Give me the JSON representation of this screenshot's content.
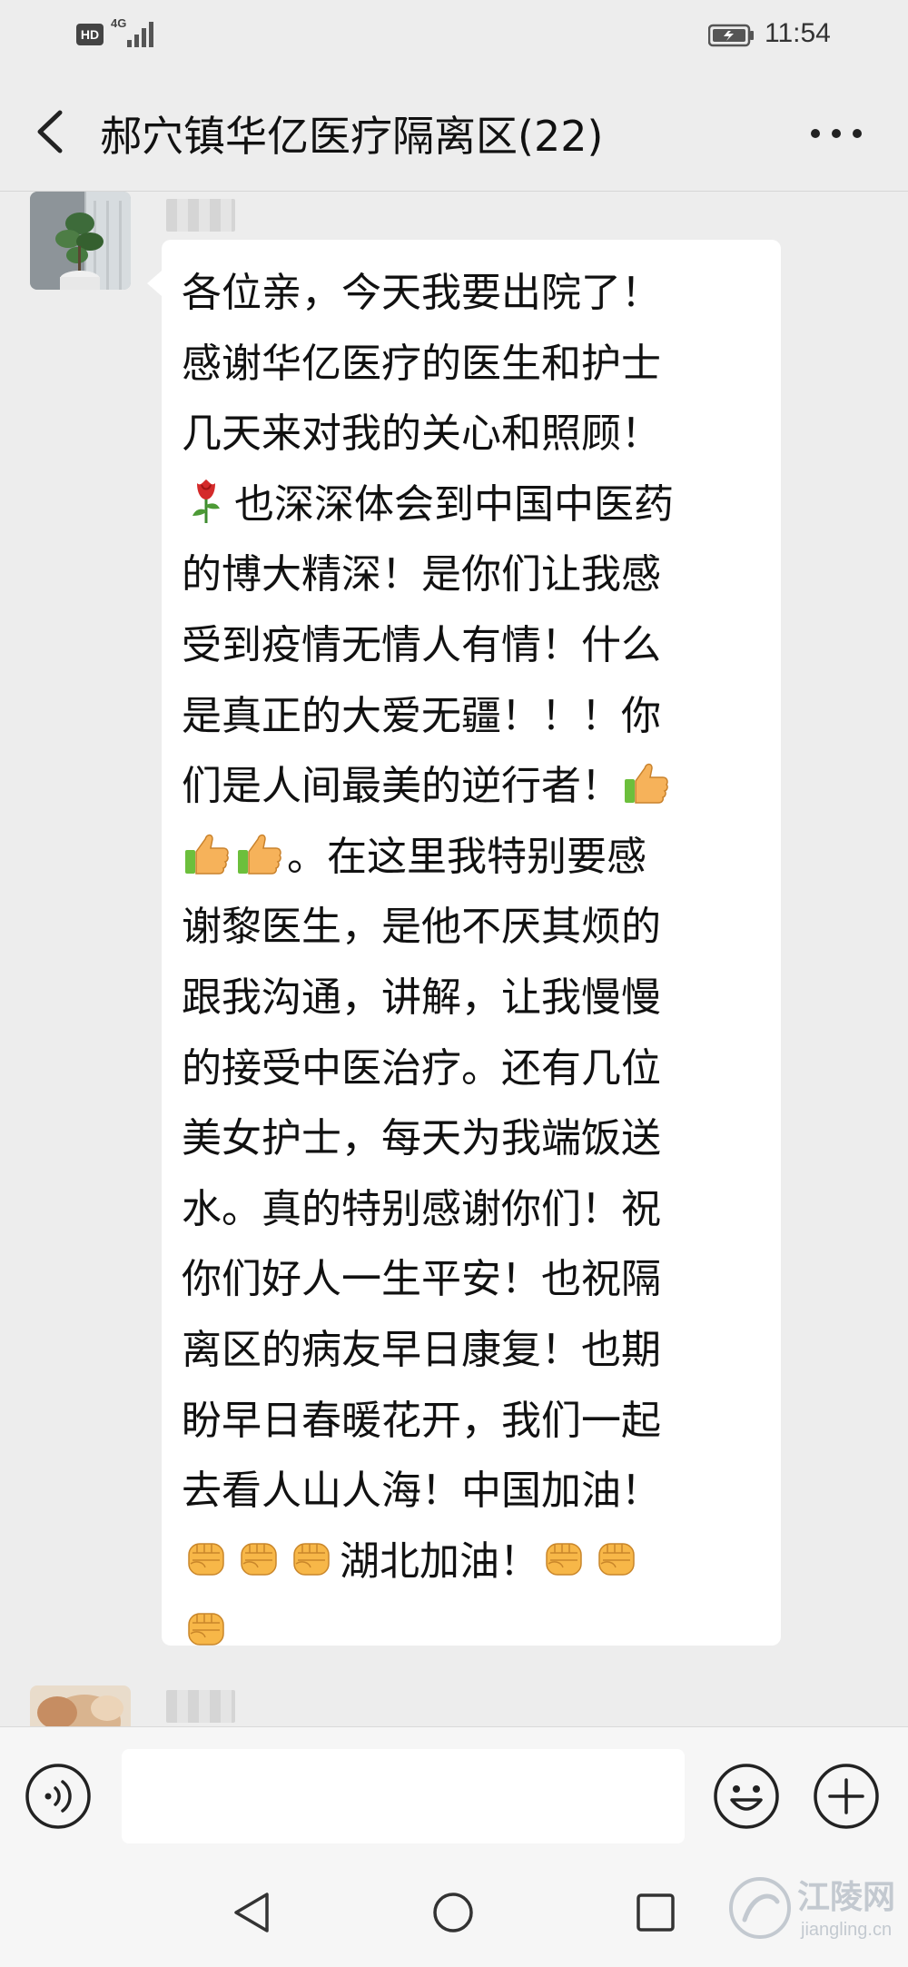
{
  "status_bar": {
    "hd_badge": "HD",
    "network": "4G",
    "time": "11:54"
  },
  "header": {
    "title": "郝穴镇华亿医疗隔离区(22)",
    "back_icon": "back-arrow-icon",
    "more_icon": "more-dots-icon"
  },
  "messages": [
    {
      "sender": "",
      "lines": [
        "各位亲，今天我要出院了！",
        "感谢华亿医疗的医生和护士",
        "几天来对我的关心和照顾！",
        "也深深体会到中国中医药",
        "的博大精深！是你们让我感",
        "受到疫情无情人有情！什么",
        "是真正的大爱无疆！！！你",
        "们是人间最美的逆行者！",
        "。在这里我特别要感",
        "谢黎医生，是他不厌其烦的",
        "跟我沟通，讲解，让我慢慢",
        "的接受中医治疗。还有几位",
        "美女护士，每天为我端饭送",
        "水。真的特别感谢你们！祝",
        "你们好人一生平安！也祝隔",
        "离区的病友早日康复！也期",
        "盼早日春暖花开，我们一起",
        "去看人山人海！中国加油！",
        "湖北加油！",
        ""
      ],
      "emojis": [
        "rose-emoji",
        "thumbs-up-emoji",
        "fist-emoji"
      ]
    },
    {
      "sender": ""
    }
  ],
  "input_bar": {
    "value": "",
    "voice_icon": "voice-icon",
    "emoji_icon": "smiley-icon",
    "plus_icon": "plus-icon"
  },
  "nav_bar": {
    "icons": [
      "nav-back-icon",
      "nav-home-icon",
      "nav-recent-icon"
    ]
  },
  "watermark": {
    "name": "江陵网",
    "domain": "jiangling.cn"
  },
  "colors": {
    "background": "#ededed",
    "bubble": "#ffffff",
    "text": "#111111"
  }
}
